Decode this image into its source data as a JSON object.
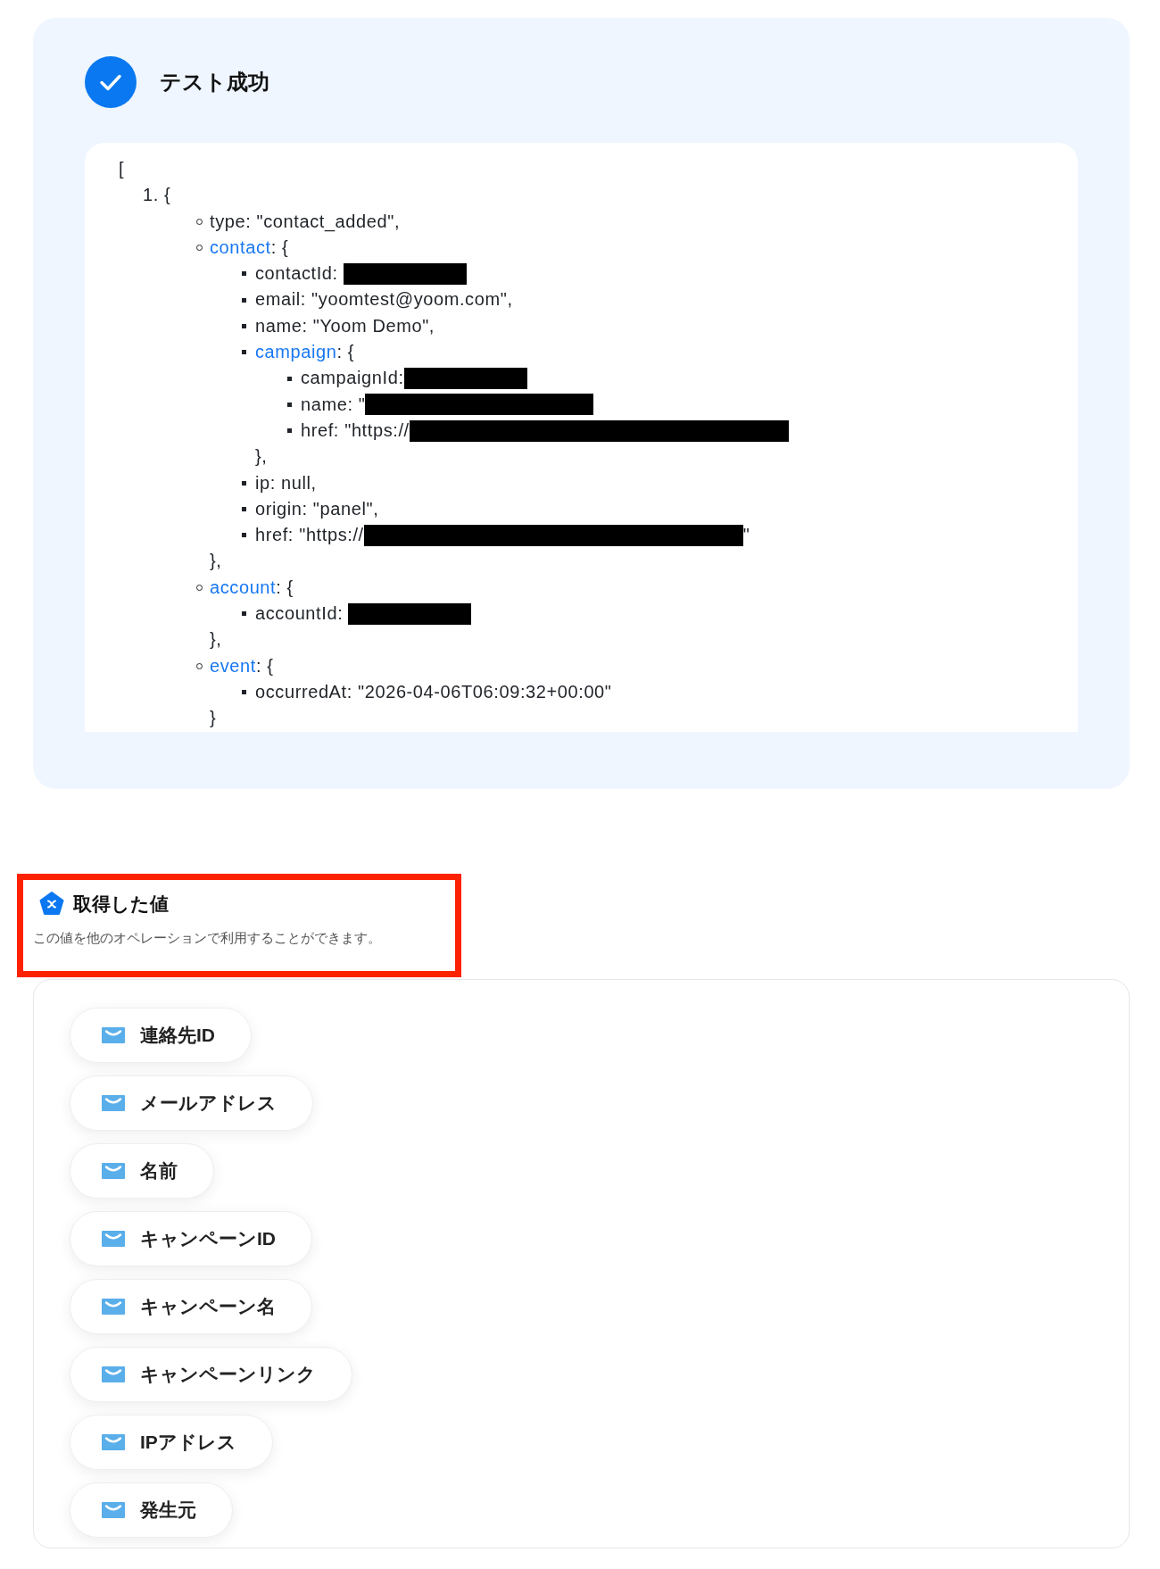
{
  "test_result": {
    "title": "テスト成功",
    "output": {
      "open": "[",
      "items": [
        {
          "marker": "1.",
          "text": "{",
          "children": [
            {
              "text": "type: \"contact_added\","
            },
            {
              "link": "contact",
              "text": ": {",
              "close": "},",
              "children": [
                {
                  "text": "contactId: ",
                  "redacted": true,
                  "kind": "short"
                },
                {
                  "text": "email: \"yoomtest@yoom.com\","
                },
                {
                  "text": "name: \"Yoom Demo\","
                },
                {
                  "link": "campaign",
                  "text": ": {",
                  "close": "},",
                  "children": [
                    {
                      "text": "campaignId:",
                      "redacted": true,
                      "kind": "short"
                    },
                    {
                      "text": "name: \"",
                      "redacted": true,
                      "kind": "medium"
                    },
                    {
                      "text": "href: \"https://",
                      "redacted": true,
                      "kind": "long"
                    }
                  ]
                },
                {
                  "text": "ip: null,"
                },
                {
                  "text": "origin: \"panel\","
                },
                {
                  "text": "href: \"https://",
                  "redacted": true,
                  "kind": "long",
                  "after": "\""
                }
              ]
            },
            {
              "link": "account",
              "text": ": {",
              "close": "},",
              "children": [
                {
                  "text": "accountId: ",
                  "redacted": true,
                  "kind": "short"
                }
              ]
            },
            {
              "link": "event",
              "text": ": {",
              "close": "}",
              "children": [
                {
                  "text": "occurredAt: \"2026-04-06T06:09:32+00:00\""
                }
              ]
            }
          ]
        }
      ]
    }
  },
  "obtained_values": {
    "title": "取得した値",
    "description": "この値を他のオペレーションで利用することができます。",
    "fields": [
      {
        "label": "連絡先ID"
      },
      {
        "label": "メールアドレス"
      },
      {
        "label": "名前"
      },
      {
        "label": "キャンペーンID"
      },
      {
        "label": "キャンペーン名"
      },
      {
        "label": "キャンペーンリンク"
      },
      {
        "label": "IPアドレス"
      },
      {
        "label": "発生元"
      }
    ]
  }
}
